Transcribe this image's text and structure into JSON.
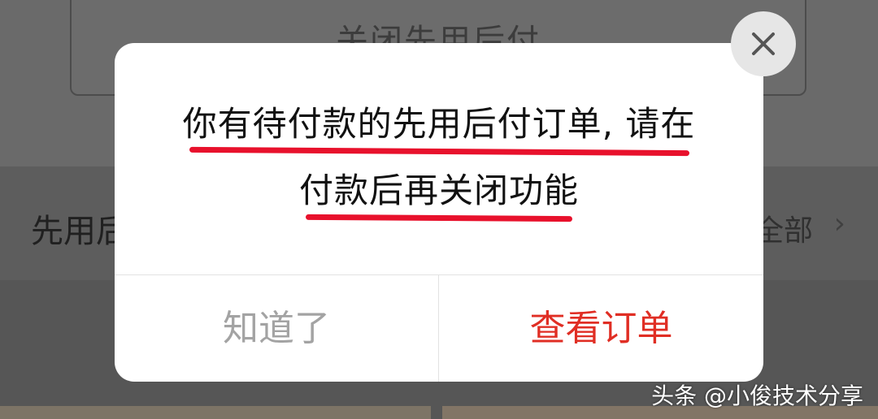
{
  "background": {
    "close_button_label": "关闭先用后付",
    "section_title": "先用后",
    "section_more": "全部",
    "chevron_icon": "chevron-right-icon"
  },
  "dialog": {
    "message_line1": "你有待付款的先用后付订单, 请在",
    "message_line2": "付款后再关闭功能",
    "ok_label": "知道了",
    "view_label": "查看订单",
    "close_icon": "close-icon",
    "accent_color": "#e02e24",
    "underline_color": "#e8112c"
  },
  "watermark": {
    "text": "头条 @小俊技术分享"
  }
}
